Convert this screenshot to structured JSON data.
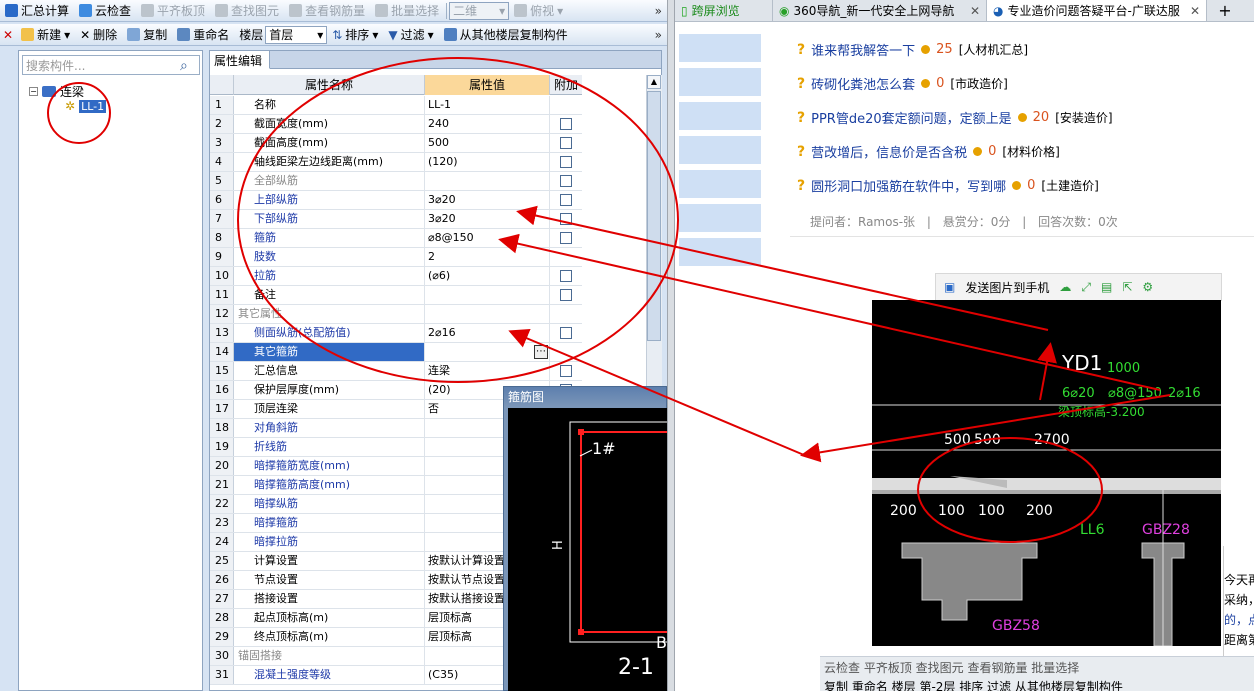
{
  "toolbar1": {
    "items": [
      "汇总计算",
      "云检查",
      "平齐板顶",
      "查找图元",
      "查看钢筋量",
      "批量选择"
    ],
    "view_combo": "二维",
    "view_combo2": "俯视"
  },
  "toolbar2": {
    "new_label": "新建",
    "delete_label": "删除",
    "copy_label": "复制",
    "rename_label": "重命名",
    "floor_label": "楼层",
    "floor_value": "首层",
    "sort_label": "排序",
    "filter_label": "过滤",
    "copy_from_floor_label": "从其他楼层复制构件"
  },
  "tree": {
    "search_placeholder": "搜索构件...",
    "root_label": "连梁",
    "child_label": "LL-1"
  },
  "grid": {
    "tab_label": "属性编辑",
    "headers": [
      "属性名称",
      "属性值",
      "附加"
    ],
    "rows": [
      {
        "n": "1",
        "name": "名称",
        "value": "LL-1",
        "style": "",
        "cb": false
      },
      {
        "n": "2",
        "name": "截面宽度(mm)",
        "value": "240",
        "style": "",
        "cb": true
      },
      {
        "n": "3",
        "name": "截面高度(mm)",
        "value": "500",
        "style": "",
        "cb": true
      },
      {
        "n": "4",
        "name": "轴线距梁左边线距离(mm)",
        "value": "(120)",
        "style": "",
        "cb": true
      },
      {
        "n": "5",
        "name": "全部纵筋",
        "value": "",
        "style": "grey",
        "cb": true
      },
      {
        "n": "6",
        "name": "上部纵筋",
        "value": "3⌀20",
        "style": "blue",
        "cb": true
      },
      {
        "n": "7",
        "name": "下部纵筋",
        "value": "3⌀20",
        "style": "blue",
        "cb": true
      },
      {
        "n": "8",
        "name": "箍筋",
        "value": "⌀8@150",
        "style": "blue",
        "cb": true
      },
      {
        "n": "9",
        "name": "肢数",
        "value": "2",
        "style": "blue",
        "cb": false
      },
      {
        "n": "10",
        "name": "拉筋",
        "value": "(⌀6)",
        "style": "blue",
        "cb": true
      },
      {
        "n": "11",
        "name": "备注",
        "value": "",
        "style": "",
        "cb": true
      },
      {
        "n": "12",
        "name": "其它属性",
        "value": "",
        "style": "grey",
        "cb": false
      },
      {
        "n": "13",
        "name": "侧面纵筋(总配筋值)",
        "value": "2⌀16",
        "style": "blue",
        "cb": true
      },
      {
        "n": "14",
        "name": "其它箍筋",
        "value": "",
        "style": "sel",
        "cb": false
      },
      {
        "n": "15",
        "name": "汇总信息",
        "value": "连梁",
        "style": "",
        "cb": true
      },
      {
        "n": "16",
        "name": "保护层厚度(mm)",
        "value": "(20)",
        "style": "",
        "cb": true
      },
      {
        "n": "17",
        "name": "顶层连梁",
        "value": "否",
        "style": "",
        "cb": false
      },
      {
        "n": "18",
        "name": "对角斜筋",
        "value": "",
        "style": "blue",
        "cb": false
      },
      {
        "n": "19",
        "name": "折线筋",
        "value": "",
        "style": "blue",
        "cb": false
      },
      {
        "n": "20",
        "name": "暗撑箍筋宽度(mm)",
        "value": "",
        "style": "blue",
        "cb": false
      },
      {
        "n": "21",
        "name": "暗撑箍筋高度(mm)",
        "value": "",
        "style": "blue",
        "cb": false
      },
      {
        "n": "22",
        "name": "暗撑纵筋",
        "value": "",
        "style": "blue",
        "cb": false
      },
      {
        "n": "23",
        "name": "暗撑箍筋",
        "value": "",
        "style": "blue",
        "cb": false
      },
      {
        "n": "24",
        "name": "暗撑拉筋",
        "value": "",
        "style": "blue",
        "cb": false
      },
      {
        "n": "25",
        "name": "计算设置",
        "value": "按默认计算设置",
        "style": "",
        "cb": false
      },
      {
        "n": "26",
        "name": "节点设置",
        "value": "按默认节点设置",
        "style": "",
        "cb": false
      },
      {
        "n": "27",
        "name": "搭接设置",
        "value": "按默认搭接设置",
        "style": "",
        "cb": false
      },
      {
        "n": "28",
        "name": "起点顶标高(m)",
        "value": "层顶标高",
        "style": "",
        "cb": false
      },
      {
        "n": "29",
        "name": "终点顶标高(m)",
        "value": "层顶标高",
        "style": "",
        "cb": false
      },
      {
        "n": "30",
        "name": "锚固搭接",
        "value": "",
        "style": "grey",
        "cb": false
      },
      {
        "n": "31",
        "name": "混凝土强度等级",
        "value": "(C35)",
        "style": "blue",
        "cb": false
      }
    ]
  },
  "popup": {
    "title": "箍筋图",
    "label_1": "1#",
    "label_h": "H",
    "label_b": "B",
    "label_section": "2-1"
  },
  "browser": {
    "tabs": [
      "跨屏浏览",
      "360导航_新一代安全上网导航",
      "专业造价问题答疑平台-广联达服"
    ],
    "new_tab": "+"
  },
  "questions": [
    {
      "text": "谁来帮我解答一下",
      "reward": "25",
      "cat": "[人材机汇总]"
    },
    {
      "text": "砖砌化粪池怎么套",
      "reward": "0",
      "cat": "[市政造价]"
    },
    {
      "text": "PPR管de20套定额问题，定额上是",
      "reward": "20",
      "cat": "[安装造价]"
    },
    {
      "text": "营改增后，信息价是否含税",
      "reward": "0",
      "cat": "[材料价格]"
    },
    {
      "text": "圆形洞口加强筋在软件中，写到哪",
      "reward": "0",
      "cat": "[土建造价]"
    }
  ],
  "meta": {
    "asker": "提问者：Ramos-张",
    "bounty": "悬赏分：0分",
    "answers": "回答次数：0次"
  },
  "image_toolbar": {
    "send_label": "发送图片到手机"
  },
  "cad": {
    "title": "YD1",
    "t1000": "1000",
    "rebar": "6⌀20",
    "stirrup": "⌀8@150",
    "side": "2⌀16",
    "elev": "梁顶标高-3.200",
    "d500a": "500",
    "d500b": "500",
    "d2700": "2700",
    "d200a": "200",
    "d100a": "100",
    "d100b": "100",
    "d200b": "200",
    "ll6": "LL6",
    "gbz28": "GBZ28",
    "gbz58": "GBZ58"
  },
  "bottom_strip": {
    "line1": "云检查  平齐板顶  查找图元  查看钢筋量  批量选择",
    "line2": "复制  重命名  楼层  第-2层  排序  过滤  从其他楼层复制构件"
  },
  "cutoff": {
    "l1": "今天再有",
    "l2": "采纳，当",
    "l3": "的，点击",
    "l4": "距离第"
  },
  "colors": {
    "accent_blue": "#316ac5",
    "annotation_red": "#e00000",
    "cad_green": "#33dd33",
    "cad_magenta": "#e040e0"
  }
}
